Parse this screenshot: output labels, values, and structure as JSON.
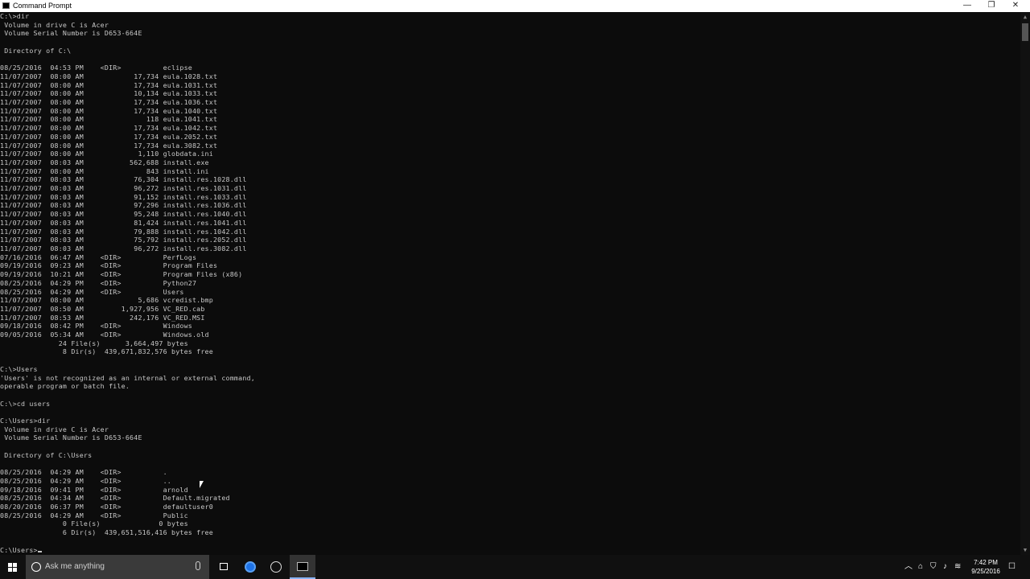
{
  "window": {
    "title": "Command Prompt",
    "controls": [
      "—",
      "❐",
      "✕"
    ]
  },
  "console": {
    "lines": [
      "C:\\>dir",
      " Volume in drive C is Acer",
      " Volume Serial Number is D653-664E",
      "",
      " Directory of C:\\",
      "",
      "08/25/2016  04:53 PM    <DIR>          eclipse",
      "11/07/2007  08:00 AM            17,734 eula.1028.txt",
      "11/07/2007  08:00 AM            17,734 eula.1031.txt",
      "11/07/2007  08:00 AM            10,134 eula.1033.txt",
      "11/07/2007  08:00 AM            17,734 eula.1036.txt",
      "11/07/2007  08:00 AM            17,734 eula.1040.txt",
      "11/07/2007  08:00 AM               118 eula.1041.txt",
      "11/07/2007  08:00 AM            17,734 eula.1042.txt",
      "11/07/2007  08:00 AM            17,734 eula.2052.txt",
      "11/07/2007  08:00 AM            17,734 eula.3082.txt",
      "11/07/2007  08:00 AM             1,110 globdata.ini",
      "11/07/2007  08:03 AM           562,688 install.exe",
      "11/07/2007  08:00 AM               843 install.ini",
      "11/07/2007  08:03 AM            76,304 install.res.1028.dll",
      "11/07/2007  08:03 AM            96,272 install.res.1031.dll",
      "11/07/2007  08:03 AM            91,152 install.res.1033.dll",
      "11/07/2007  08:03 AM            97,296 install.res.1036.dll",
      "11/07/2007  08:03 AM            95,248 install.res.1040.dll",
      "11/07/2007  08:03 AM            81,424 install.res.1041.dll",
      "11/07/2007  08:03 AM            79,888 install.res.1042.dll",
      "11/07/2007  08:03 AM            75,792 install.res.2052.dll",
      "11/07/2007  08:03 AM            96,272 install.res.3082.dll",
      "07/16/2016  06:47 AM    <DIR>          PerfLogs",
      "09/19/2016  09:23 AM    <DIR>          Program Files",
      "09/19/2016  10:21 AM    <DIR>          Program Files (x86)",
      "08/25/2016  04:29 PM    <DIR>          Python27",
      "08/25/2016  04:29 AM    <DIR>          Users",
      "11/07/2007  08:00 AM             5,686 vcredist.bmp",
      "11/07/2007  08:50 AM         1,927,956 VC_RED.cab",
      "11/07/2007  08:53 AM           242,176 VC_RED.MSI",
      "09/18/2016  08:42 PM    <DIR>          Windows",
      "09/05/2016  05:34 AM    <DIR>          Windows.old",
      "              24 File(s)      3,664,497 bytes",
      "               8 Dir(s)  439,671,832,576 bytes free",
      "",
      "C:\\>Users",
      "'Users' is not recognized as an internal or external command,",
      "operable program or batch file.",
      "",
      "C:\\>cd users",
      "",
      "C:\\Users>dir",
      " Volume in drive C is Acer",
      " Volume Serial Number is D653-664E",
      "",
      " Directory of C:\\Users",
      "",
      "08/25/2016  04:29 AM    <DIR>          .",
      "08/25/2016  04:29 AM    <DIR>          ..",
      "09/18/2016  09:41 PM    <DIR>          arnold",
      "08/25/2016  04:34 AM    <DIR>          Default.migrated",
      "08/20/2016  06:37 PM    <DIR>          defaultuser0",
      "08/25/2016  04:29 AM    <DIR>          Public",
      "               0 File(s)              0 bytes",
      "               6 Dir(s)  439,651,516,416 bytes free",
      ""
    ],
    "prompt": "C:\\Users>"
  },
  "taskbar": {
    "search_placeholder": "Ask me anything",
    "clock_time": "7:42 PM",
    "clock_date": "9/25/2016"
  }
}
